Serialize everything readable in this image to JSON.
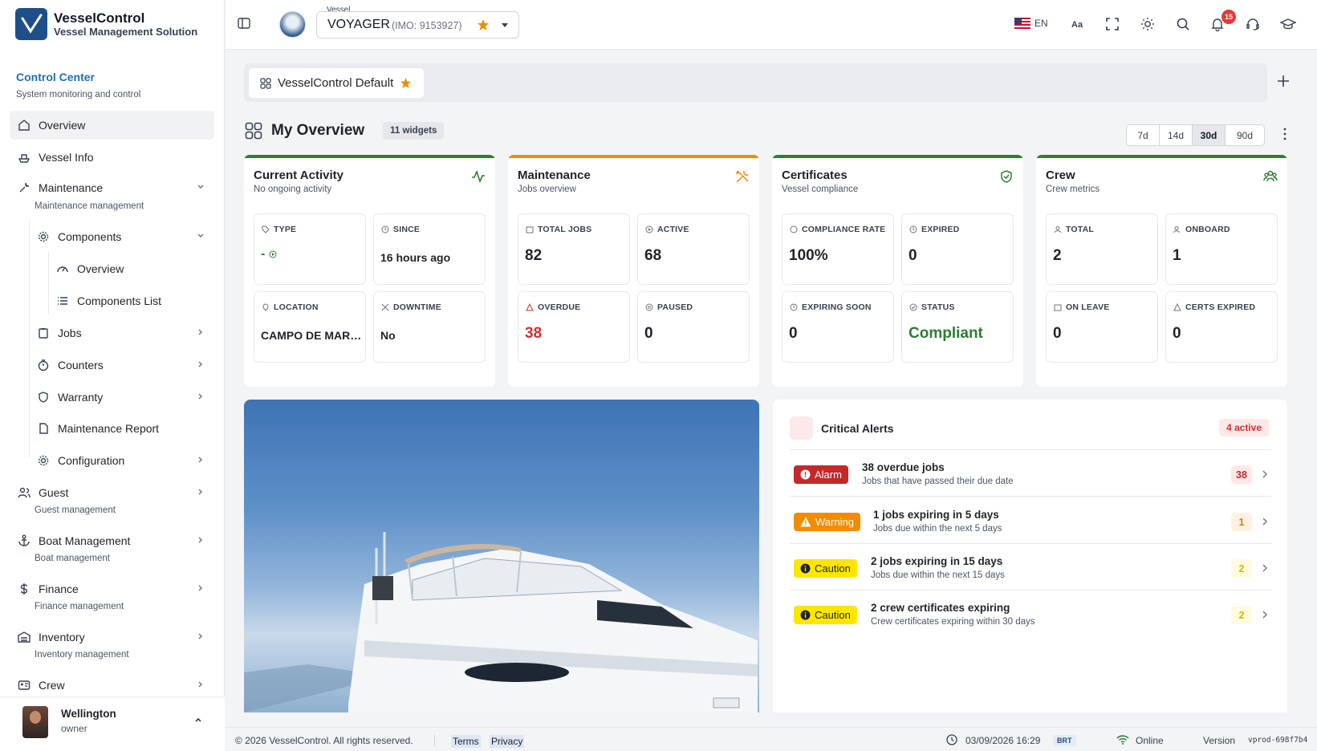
{
  "app": {
    "name": "VesselControl",
    "subtitle": "Vessel Management Solution"
  },
  "sidebar": {
    "section_title": "Control Center",
    "section_sub": "System monitoring and control",
    "items": [
      {
        "label": "Overview"
      },
      {
        "label": "Vessel Info"
      },
      {
        "label": "Maintenance",
        "sub": "Maintenance management"
      },
      {
        "label": "Components"
      },
      {
        "label": "Overview"
      },
      {
        "label": "Components List"
      },
      {
        "label": "Jobs"
      },
      {
        "label": "Counters"
      },
      {
        "label": "Warranty"
      },
      {
        "label": "Maintenance Report"
      },
      {
        "label": "Configuration"
      },
      {
        "label": "Guest",
        "sub": "Guest management"
      },
      {
        "label": "Boat Management",
        "sub": "Boat management"
      },
      {
        "label": "Finance",
        "sub": "Finance management"
      },
      {
        "label": "Inventory",
        "sub": "Inventory management"
      },
      {
        "label": "Crew"
      }
    ],
    "user": {
      "name": "Wellington",
      "role": "owner"
    }
  },
  "topbar": {
    "vessel_label": "Vessel",
    "vessel_name": "VOYAGER",
    "vessel_imo": "(IMO: 9153927)",
    "language": "EN",
    "notifications_count": "15"
  },
  "dashboard": {
    "tab_label": "VesselControl Default",
    "title": "My Overview",
    "widgets_badge": "11 widgets",
    "ranges": [
      "7d",
      "14d",
      "30d",
      "90d"
    ],
    "selected_range": "30d"
  },
  "cards": {
    "activity": {
      "title": "Current Activity",
      "sub": "No ongoing activity",
      "accent": "#2e7d32",
      "metrics": [
        {
          "label": "TYPE",
          "value": "-"
        },
        {
          "label": "SINCE",
          "value": "16 hours ago"
        },
        {
          "label": "LOCATION",
          "value": "CAMPO DE MARL..."
        },
        {
          "label": "DOWNTIME",
          "value": "No"
        }
      ]
    },
    "maintenance": {
      "title": "Maintenance",
      "sub": "Jobs overview",
      "accent": "#ef8a17",
      "metrics": [
        {
          "label": "TOTAL JOBS",
          "value": "82"
        },
        {
          "label": "ACTIVE",
          "value": "68"
        },
        {
          "label": "OVERDUE",
          "value": "38"
        },
        {
          "label": "PAUSED",
          "value": "0"
        }
      ]
    },
    "certificates": {
      "title": "Certificates",
      "sub": "Vessel compliance",
      "accent": "#2e7d32",
      "metrics": [
        {
          "label": "COMPLIANCE RATE",
          "value": "100%"
        },
        {
          "label": "EXPIRED",
          "value": "0"
        },
        {
          "label": "EXPIRING SOON",
          "value": "0"
        },
        {
          "label": "STATUS",
          "value": "Compliant"
        }
      ]
    },
    "crew": {
      "title": "Crew",
      "sub": "Crew metrics",
      "accent": "#2e7d32",
      "metrics": [
        {
          "label": "TOTAL",
          "value": "2"
        },
        {
          "label": "ONBOARD",
          "value": "1"
        },
        {
          "label": "ON LEAVE",
          "value": "0"
        },
        {
          "label": "CERTS EXPIRED",
          "value": "0"
        }
      ]
    }
  },
  "alerts": {
    "title": "Critical Alerts",
    "active_badge": "4 active",
    "rows": [
      {
        "severity": "Alarm",
        "title": "38 overdue jobs",
        "desc": "Jobs that have passed their due date",
        "count": "38"
      },
      {
        "severity": "Warning",
        "title": "1 jobs expiring in 5 days",
        "desc": "Jobs due within the next 5 days",
        "count": "1"
      },
      {
        "severity": "Caution",
        "title": "2 jobs expiring in 15 days",
        "desc": "Jobs due within the next 15 days",
        "count": "2"
      },
      {
        "severity": "Caution",
        "title": "2 crew certificates expiring",
        "desc": "Crew certificates expiring within 30 days",
        "count": "2"
      }
    ]
  },
  "footer": {
    "copyright": "© 2026 VesselControl. All rights reserved.",
    "terms": "Terms",
    "privacy": "Privacy",
    "datetime": "03/09/2026 16:29",
    "timezone": "BRT",
    "status": "Online",
    "version_label": "Version",
    "version_code": "vprod-698f7b4"
  },
  "colors": {
    "brand_blue": "#1d6fb8",
    "alarm": "#c62828",
    "warning": "#f08c00",
    "caution": "#ffe600",
    "success": "#2e7d32"
  }
}
